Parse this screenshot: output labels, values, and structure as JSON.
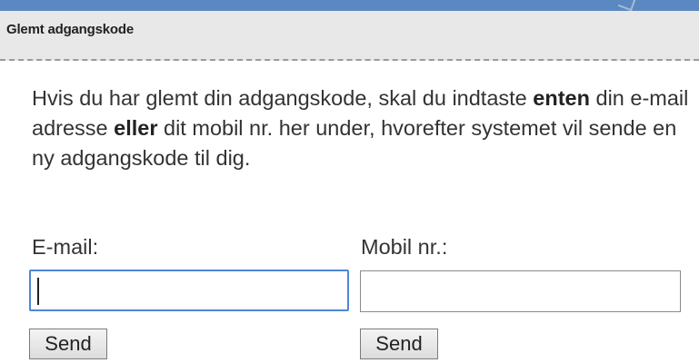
{
  "header": {
    "title": "Glemt adgangskode"
  },
  "intro": {
    "part1": "Hvis du har glemt din adgangskode, skal du indtaste ",
    "bold1": "enten",
    "part2": " din e-mail adresse ",
    "bold2": "eller",
    "part3": " dit mobil nr. her under, hvorefter systemet vil sende en ny adgangskode til dig."
  },
  "email": {
    "label": "E-mail:",
    "value": "",
    "button_label": "Send"
  },
  "mobile": {
    "label": "Mobil nr.:",
    "value": "",
    "button_label": "Send"
  },
  "colors": {
    "top_bar": "#5b88c0",
    "header_bg": "#e8e8e8",
    "focus_border": "#4f86d9"
  }
}
